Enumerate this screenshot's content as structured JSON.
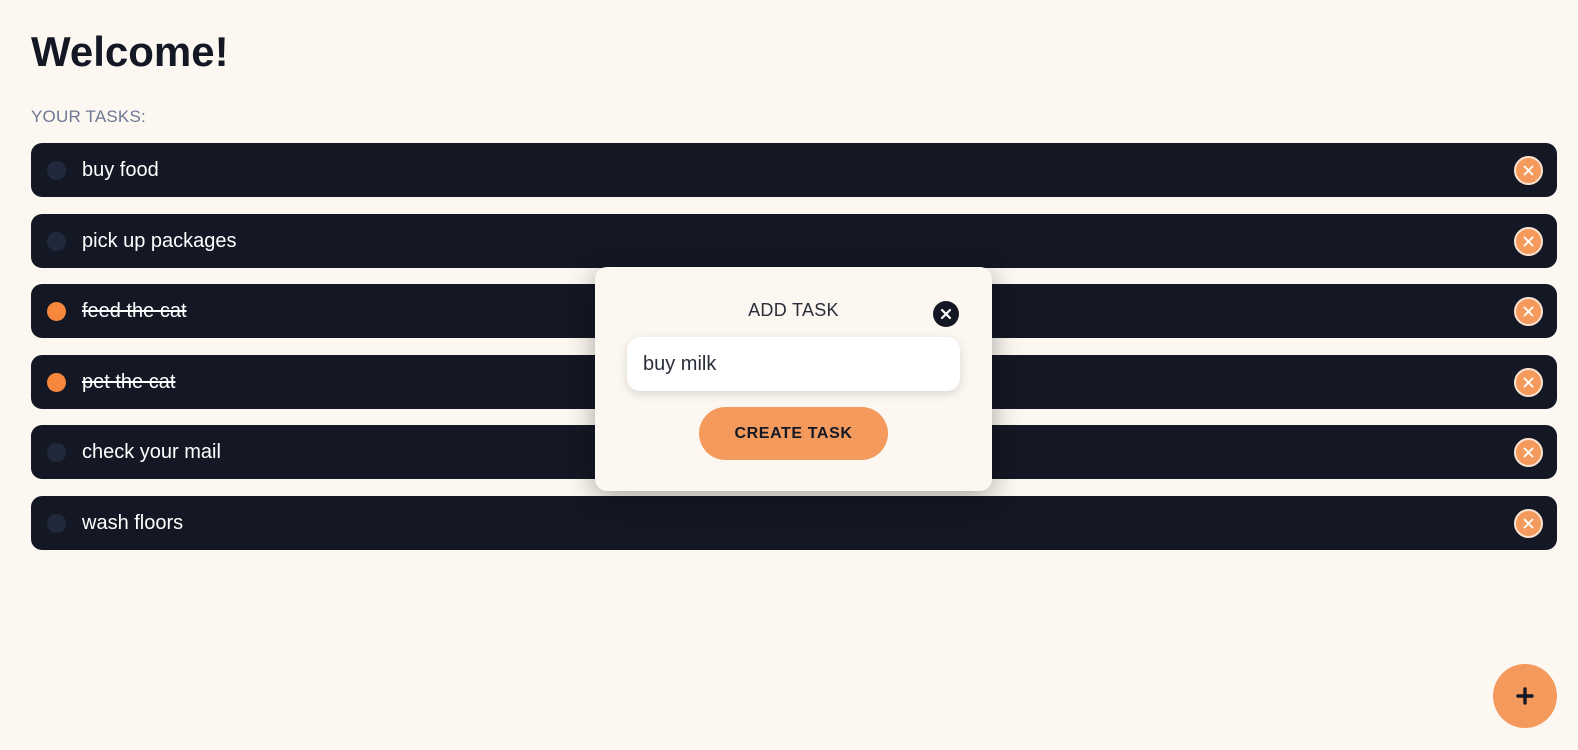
{
  "header": {
    "title": "Welcome!",
    "section_label": "YOUR TASKS:"
  },
  "tasks": [
    {
      "text": "buy food",
      "done": false
    },
    {
      "text": "pick up packages",
      "done": false
    },
    {
      "text": "feed the cat",
      "done": true
    },
    {
      "text": "pet the cat",
      "done": true
    },
    {
      "text": "check your mail",
      "done": false
    },
    {
      "text": "wash floors",
      "done": false
    }
  ],
  "modal": {
    "title": "ADD TASK",
    "input_value": "buy milk",
    "create_label": "CREATE TASK"
  },
  "icons": {
    "task_delete": "close-icon",
    "modal_close": "close-icon",
    "fab": "plus-icon"
  },
  "colors": {
    "background": "#fcf7f1",
    "task_row": "#141824",
    "accent": "#f39a5c",
    "done_check": "#f7873d",
    "pending_check": "#212a3d",
    "section_label": "#6d7894"
  }
}
